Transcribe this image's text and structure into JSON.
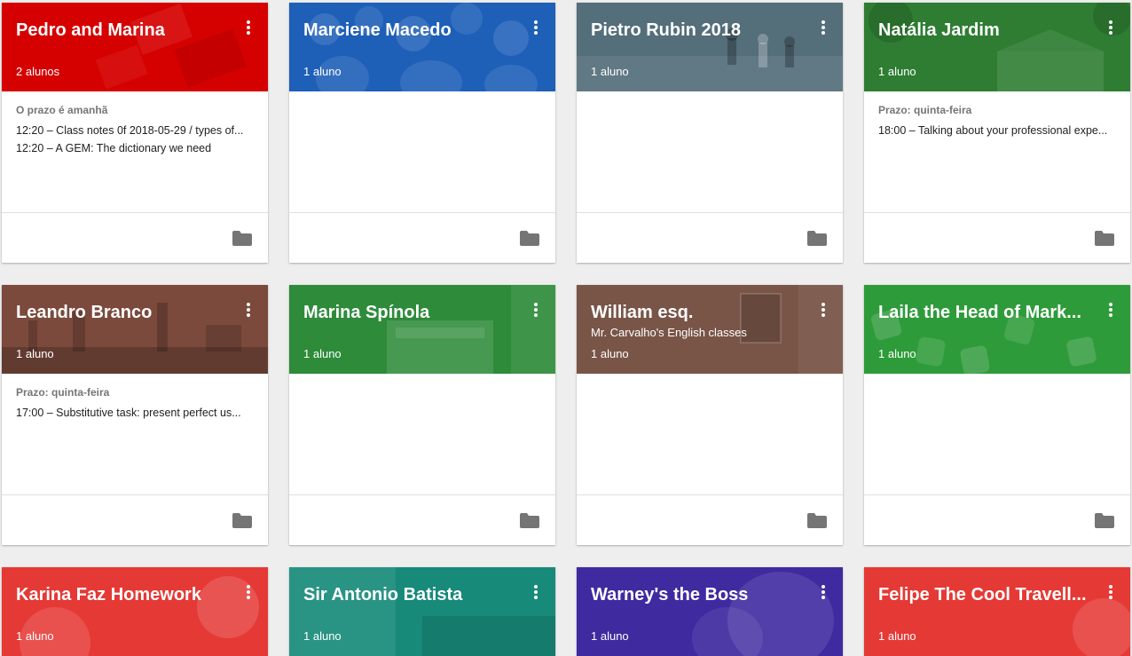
{
  "classes": [
    {
      "title": "Pedro and Marina",
      "subtitle": "",
      "count": "2 alunos",
      "due": "O prazo é amanhã",
      "tasks": [
        "12:20 – Class notes 0f 2018-05-29 / types of...",
        "12:20 – A GEM: The dictionary we need"
      ],
      "color": "#d50000"
    },
    {
      "title": "Marciene Macedo",
      "subtitle": "",
      "count": "1 aluno",
      "due": "",
      "tasks": [],
      "color": "#1e5fb8"
    },
    {
      "title": "Pietro Rubin 2018",
      "subtitle": "",
      "count": "1 aluno",
      "due": "",
      "tasks": [],
      "color": "#546e7a"
    },
    {
      "title": "Natália Jardim",
      "subtitle": "",
      "count": "1 aluno",
      "due": "Prazo: quinta-feira",
      "tasks": [
        "18:00 – Talking about your professional expe..."
      ],
      "color": "#2e7d32"
    },
    {
      "title": "Leandro Branco",
      "subtitle": "",
      "count": "1 aluno",
      "due": "Prazo: quinta-feira",
      "tasks": [
        "17:00 – Substitutive task: present perfect us..."
      ],
      "color": "#7b4a3d"
    },
    {
      "title": "Marina Spínola",
      "subtitle": "",
      "count": "1 aluno",
      "due": "",
      "tasks": [],
      "color": "#2e8b3a"
    },
    {
      "title": "William esq.",
      "subtitle": "Mr. Carvalho's English classes",
      "count": "1 aluno",
      "due": "",
      "tasks": [],
      "color": "#795548"
    },
    {
      "title": "Laila the Head of Mark...",
      "subtitle": "",
      "count": "1 aluno",
      "due": "",
      "tasks": [],
      "color": "#2e9b3a"
    },
    {
      "title": "Karina Faz Homework",
      "subtitle": "",
      "count": "1 aluno",
      "due": "",
      "tasks": [],
      "color": "#e53935"
    },
    {
      "title": "Sir Antonio Batista",
      "subtitle": "",
      "count": "1 aluno",
      "due": "",
      "tasks": [],
      "color": "#178a7a"
    },
    {
      "title": "Warney's the Boss",
      "subtitle": "",
      "count": "1 aluno",
      "due": "",
      "tasks": [],
      "color": "#3f2aa0"
    },
    {
      "title": "Felipe The Cool Travell...",
      "subtitle": "",
      "count": "1 aluno",
      "due": "",
      "tasks": [],
      "color": "#e53935"
    }
  ]
}
